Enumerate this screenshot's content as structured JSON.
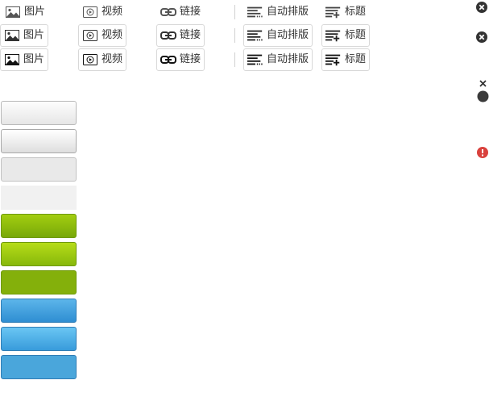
{
  "toolbar_rows": [
    {
      "state": "normal",
      "image_label": "图片",
      "video_label": "视频",
      "link_label": "链接",
      "autoformat_label": "自动排版",
      "heading_label": "标题"
    },
    {
      "state": "hover",
      "image_label": "图片",
      "video_label": "视频",
      "link_label": "链接",
      "autoformat_label": "自动排版",
      "heading_label": "标题"
    },
    {
      "state": "active",
      "image_label": "图片",
      "video_label": "视频",
      "link_label": "链接",
      "autoformat_label": "自动排版",
      "heading_label": "标题"
    }
  ],
  "button_samples": [
    {
      "variant": "gray",
      "state": "normal"
    },
    {
      "variant": "gray",
      "state": "hover"
    },
    {
      "variant": "gray",
      "state": "active"
    },
    {
      "variant": "gray",
      "state": "disabled"
    },
    {
      "variant": "green",
      "state": "normal"
    },
    {
      "variant": "green",
      "state": "hover"
    },
    {
      "variant": "green",
      "state": "active"
    },
    {
      "variant": "blue",
      "state": "normal"
    },
    {
      "variant": "blue",
      "state": "hover"
    },
    {
      "variant": "blue",
      "state": "active"
    }
  ],
  "side_icons": [
    "close-circle-icon",
    "close-circle-icon",
    "small-close-icon",
    "dot-icon",
    "error-icon"
  ],
  "colors": {
    "icon": "#555555",
    "icon_dark": "#333333",
    "green": "#8ab80c",
    "blue": "#3a9ad9",
    "error": "#d9413d"
  }
}
